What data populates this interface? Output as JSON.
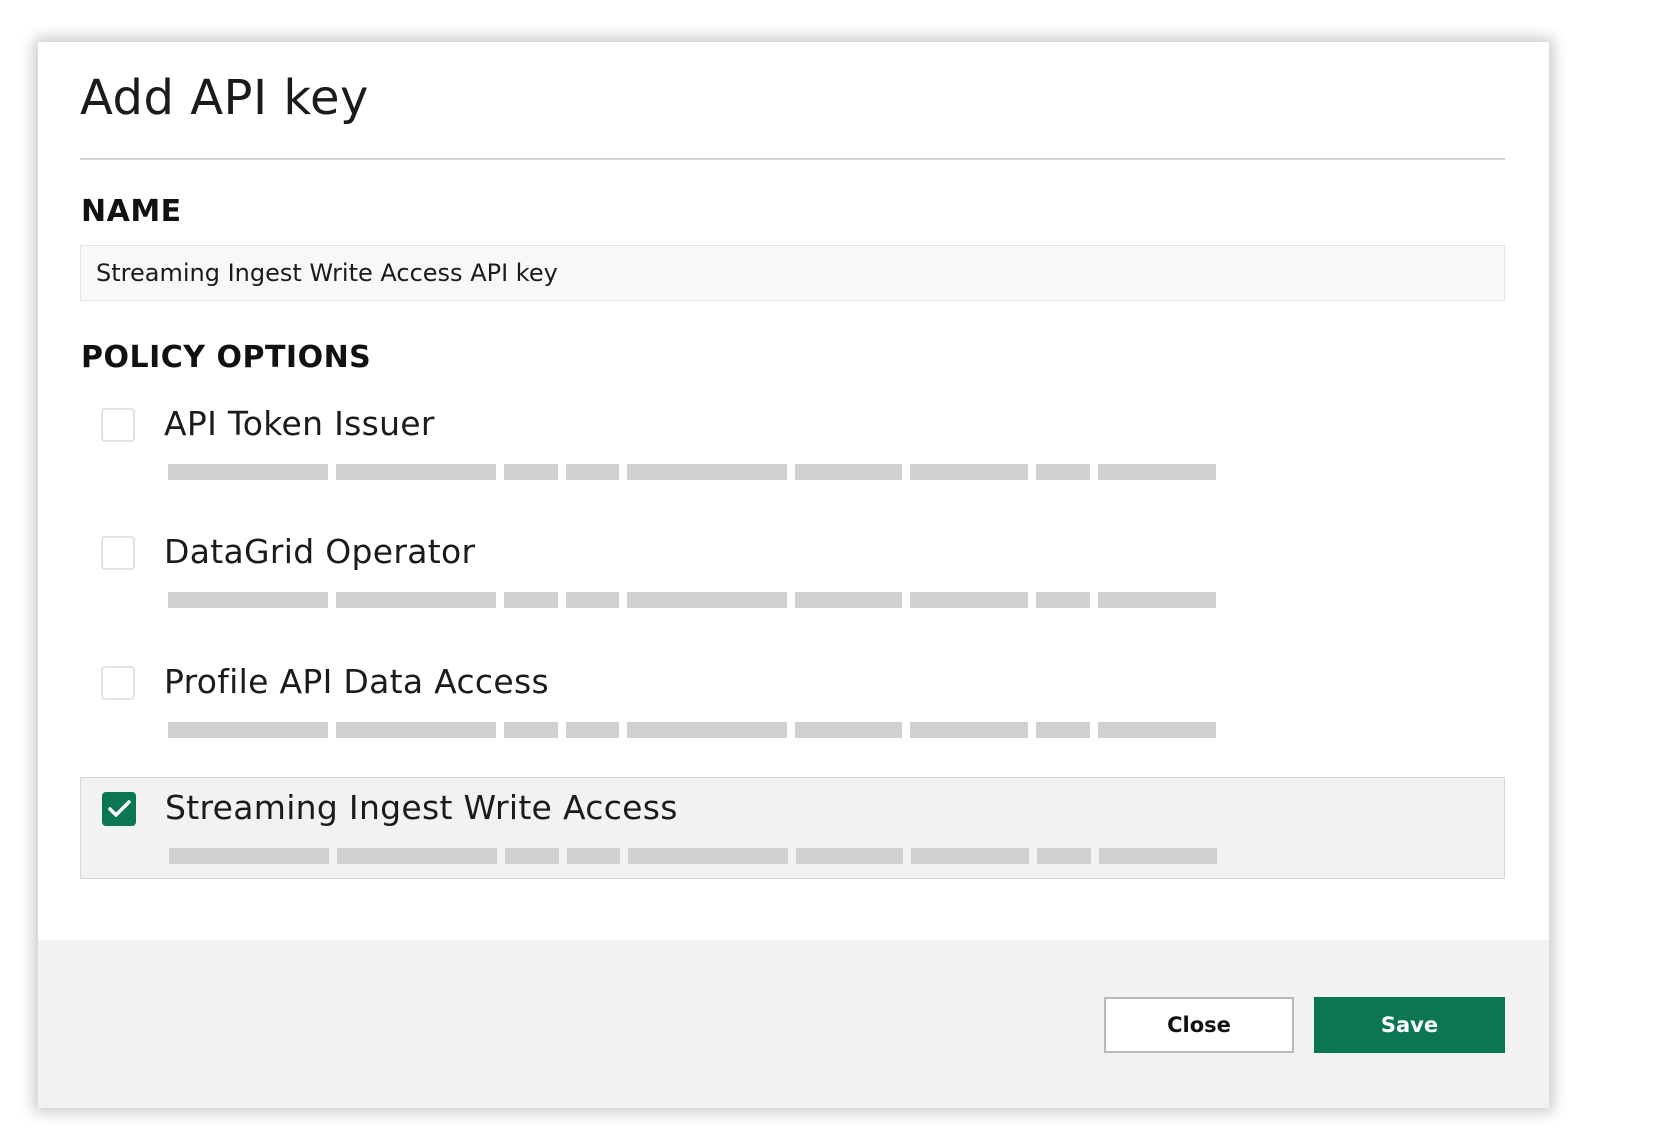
{
  "dialog": {
    "title": "Add API key"
  },
  "name_section": {
    "label": "NAME",
    "value": "Streaming Ingest Write Access API key"
  },
  "policy_section": {
    "label": "POLICY OPTIONS",
    "options": [
      {
        "label": "API Token Issuer",
        "checked": false
      },
      {
        "label": "DataGrid Operator",
        "checked": false
      },
      {
        "label": "Profile API Data Access",
        "checked": false
      },
      {
        "label": "Streaming Ingest Write Access",
        "checked": true
      }
    ]
  },
  "footer": {
    "close_label": "Close",
    "save_label": "Save"
  },
  "colors": {
    "accent": "#0a7653",
    "footer_bg": "#f1f2f1",
    "redacted_bar": "#cfd1d1"
  }
}
